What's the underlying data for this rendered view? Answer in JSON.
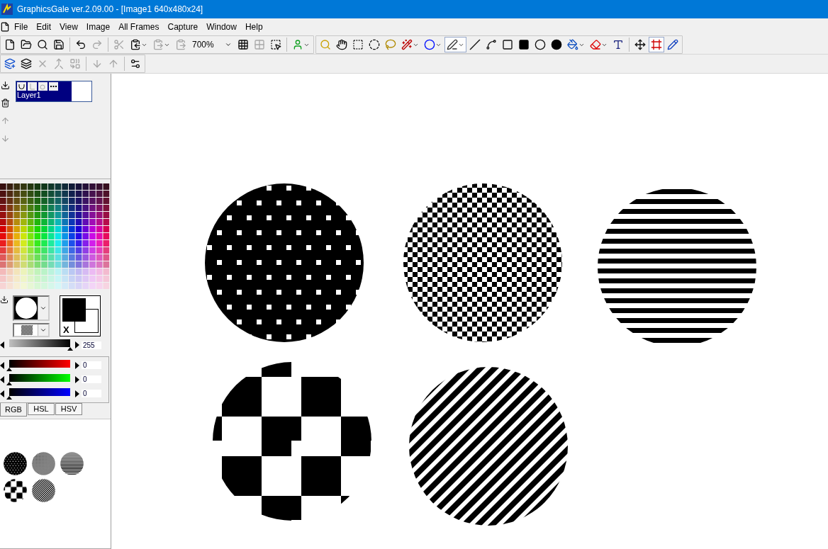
{
  "window": {
    "title": "GraphicsGale ver.2.09.00 - [Image1 640x480x24]"
  },
  "menu": [
    "File",
    "Edit",
    "View",
    "Image",
    "All Frames",
    "Capture",
    "Window",
    "Help"
  ],
  "toolbar_main": {
    "buttons": [
      {
        "disabled": false
      },
      {
        "disabled": false
      },
      {
        "disabled": false
      },
      {
        "disabled": false
      },
      {
        "disabled": false
      },
      {
        "disabled": true
      },
      {
        "disabled": true
      },
      {
        "disabled": false
      },
      {
        "disabled": true
      },
      {
        "disabled": true
      },
      {
        "disabled": false
      },
      {
        "disabled": true
      },
      {
        "disabled": false
      },
      {
        "disabled": false
      }
    ],
    "zoom": "700%"
  },
  "toolbar_tools": [
    {
      "selected": false
    },
    {
      "selected": false
    },
    {
      "selected": false
    },
    {
      "selected": false
    },
    {
      "selected": false
    },
    {
      "selected": false
    },
    {
      "selected": false
    },
    {
      "selected": true
    },
    {
      "selected": false
    },
    {
      "selected": false
    },
    {
      "selected": false
    },
    {
      "selected": false
    },
    {
      "selected": false
    },
    {
      "selected": false
    },
    {
      "selected": false
    },
    {
      "selected": false
    },
    {
      "selected": false
    },
    {
      "selected": false
    },
    {
      "selected": true
    },
    {
      "selected": false
    }
  ],
  "toolbar_layers": [
    {
      "disabled": false
    },
    {
      "disabled": false
    },
    {
      "disabled": true
    },
    {
      "disabled": true
    },
    {
      "disabled": true
    },
    {
      "disabled": true
    },
    {
      "disabled": true
    },
    {
      "disabled": false
    }
  ],
  "layer_tools": [
    {
      "disabled": false
    },
    {
      "disabled": false
    },
    {
      "disabled": true
    },
    {
      "disabled": true
    }
  ],
  "layers": [
    {
      "name": "Layer1",
      "selected": true
    }
  ],
  "colors": {
    "swap_label": "X"
  },
  "gray_slider": {
    "level": 1,
    "reading": "255"
  },
  "rgb_sliders": [
    {
      "color": "#ff0000",
      "level": 0,
      "reading": "0"
    },
    {
      "color": "#00ff00",
      "level": 0,
      "reading": "0"
    },
    {
      "color": "#0000ff",
      "level": 0,
      "reading": "0"
    }
  ],
  "color_tabs": [
    {
      "label": "RGB",
      "selected": true
    },
    {
      "label": "HSL",
      "selected": false
    },
    {
      "label": "HSV",
      "selected": false
    }
  ],
  "previews": [
    {
      "kind": "dots"
    },
    {
      "kind": "checker"
    },
    {
      "kind": "stripes"
    },
    {
      "kind": "big-checker"
    },
    {
      "kind": "diagonal"
    }
  ],
  "canvas": {
    "shapes": [
      {
        "kind": "dots"
      },
      {
        "kind": "checker"
      },
      {
        "kind": "stripes"
      },
      {
        "kind": "big-checker"
      },
      {
        "kind": "diagonal"
      }
    ]
  }
}
